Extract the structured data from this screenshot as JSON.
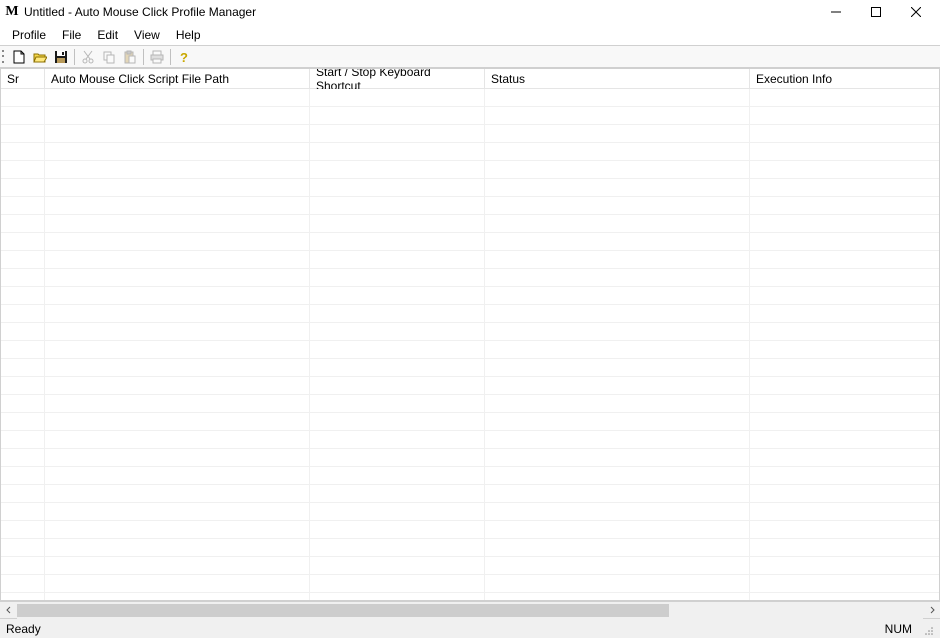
{
  "window": {
    "title": "Untitled - Auto Mouse Click Profile Manager",
    "icon_letter": "M"
  },
  "menu": {
    "items": [
      "Profile",
      "File",
      "Edit",
      "View",
      "Help"
    ]
  },
  "toolbar": {
    "buttons": [
      {
        "name": "new-icon",
        "enabled": true
      },
      {
        "name": "open-icon",
        "enabled": true
      },
      {
        "name": "save-icon",
        "enabled": true
      },
      {
        "name": "cut-icon",
        "enabled": false
      },
      {
        "name": "copy-icon",
        "enabled": false
      },
      {
        "name": "paste-icon",
        "enabled": false
      },
      {
        "name": "print-icon",
        "enabled": false
      },
      {
        "name": "help-icon",
        "enabled": true
      }
    ]
  },
  "table": {
    "columns": {
      "sr": "Sr",
      "path": "Auto Mouse Click Script File Path",
      "shortcut": "Start / Stop Keyboard Shortcut",
      "status": "Status",
      "exec": "Execution Info"
    },
    "rows": []
  },
  "statusbar": {
    "left": "Ready",
    "numlock": "NUM"
  }
}
